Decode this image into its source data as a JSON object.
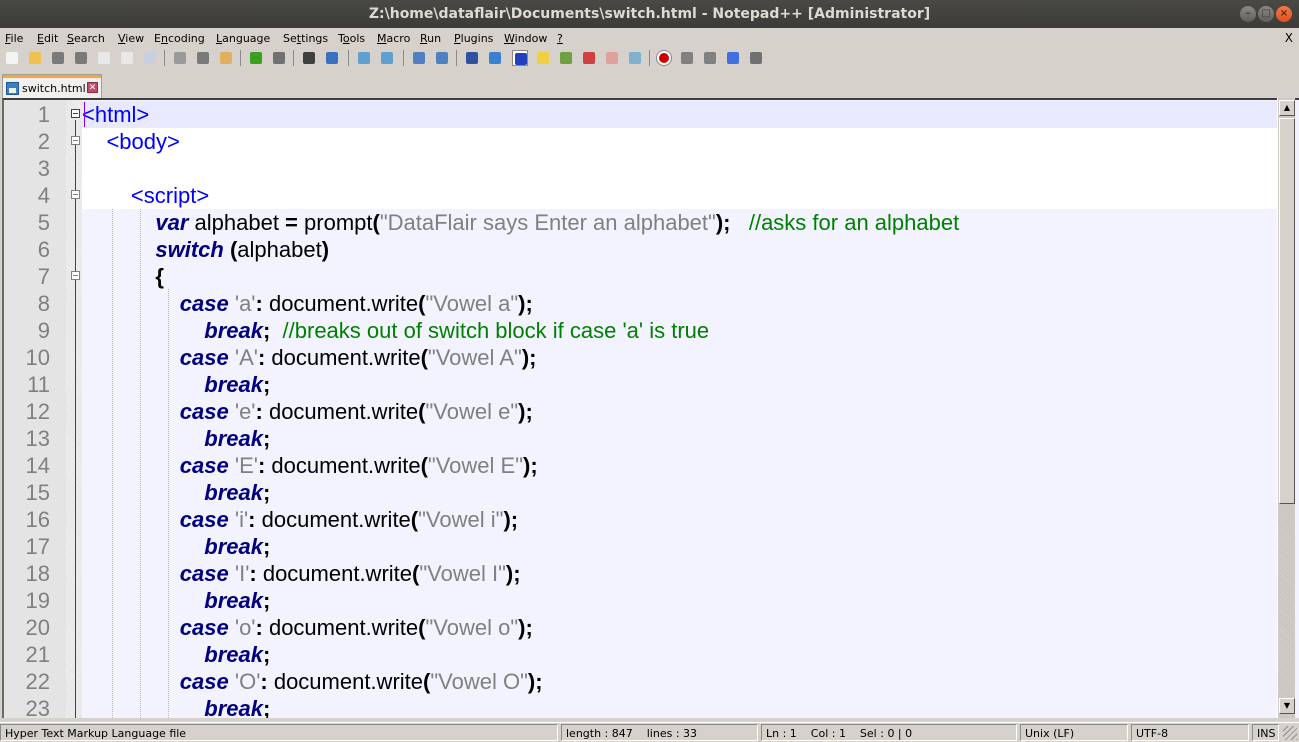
{
  "window": {
    "title": "Z:\\home\\dataflair\\Documents\\switch.html - Notepad++ [Administrator]",
    "controls": {
      "minimize": "–",
      "maximize": "□",
      "close": "×"
    }
  },
  "menu": {
    "items": [
      {
        "label": "File",
        "accel": "F"
      },
      {
        "label": "Edit",
        "accel": "E"
      },
      {
        "label": "Search",
        "accel": "S"
      },
      {
        "label": "View",
        "accel": "V"
      },
      {
        "label": "Encoding",
        "accel": "n"
      },
      {
        "label": "Language",
        "accel": "L"
      },
      {
        "label": "Settings",
        "accel": "t"
      },
      {
        "label": "Tools",
        "accel": "o"
      },
      {
        "label": "Macro",
        "accel": "M"
      },
      {
        "label": "Run",
        "accel": "R"
      },
      {
        "label": "Plugins",
        "accel": "P"
      },
      {
        "label": "Window",
        "accel": "W"
      },
      {
        "label": "?",
        "accel": "?"
      }
    ],
    "close_label": "X"
  },
  "toolbar": {
    "buttons": [
      "new-file-icon",
      "open-file-icon",
      "save-icon",
      "save-all-icon",
      "close-icon",
      "close-all-icon",
      "print-icon",
      "cut-icon",
      "copy-icon",
      "paste-icon",
      "undo-icon",
      "redo-icon",
      "find-icon",
      "replace-icon",
      "zoom-in-icon",
      "zoom-out-icon",
      "sync-vertical-icon",
      "sync-horizontal-icon",
      "word-wrap-icon",
      "show-all-chars-icon",
      "indent-guide-icon",
      "user-defined-language-icon",
      "document-map-icon",
      "function-list-icon",
      "folder-as-workspace-icon",
      "monitoring-icon",
      "record-macro-icon",
      "stop-record-icon",
      "playback-macro-icon",
      "run-macro-multiple-icon",
      "save-macro-icon"
    ]
  },
  "tabs": [
    {
      "label": "switch.html",
      "active": true,
      "close": "✕"
    }
  ],
  "editor": {
    "lines": [
      {
        "n": "1",
        "tokens": [
          [
            "tag",
            "<html>"
          ]
        ]
      },
      {
        "n": "2",
        "tokens": [
          [
            "plain",
            "    "
          ],
          [
            "tag",
            "<body>"
          ]
        ]
      },
      {
        "n": "3",
        "tokens": []
      },
      {
        "n": "4",
        "tokens": [
          [
            "plain",
            "        "
          ],
          [
            "tag",
            "<script>"
          ]
        ]
      },
      {
        "n": "5",
        "tokens": [
          [
            "plain",
            "            "
          ],
          [
            "kw",
            "var"
          ],
          [
            "plain",
            " alphabet "
          ],
          [
            "op",
            "="
          ],
          [
            "plain",
            " prompt"
          ],
          [
            "op",
            "("
          ],
          [
            "str",
            "\"DataFlair says Enter an alphabet\""
          ],
          [
            "op",
            ");"
          ],
          [
            "plain",
            "   "
          ],
          [
            "cmt",
            "//asks for an alphabet"
          ]
        ]
      },
      {
        "n": "6",
        "tokens": [
          [
            "plain",
            "            "
          ],
          [
            "kw",
            "switch"
          ],
          [
            "plain",
            " "
          ],
          [
            "op",
            "("
          ],
          [
            "plain",
            "alphabet"
          ],
          [
            "op",
            ")"
          ]
        ]
      },
      {
        "n": "7",
        "tokens": [
          [
            "plain",
            "            "
          ],
          [
            "op",
            "{"
          ]
        ]
      },
      {
        "n": "8",
        "tokens": [
          [
            "plain",
            "                "
          ],
          [
            "kw",
            "case"
          ],
          [
            "plain",
            " "
          ],
          [
            "str",
            "'a'"
          ],
          [
            "op",
            ":"
          ],
          [
            "plain",
            " document.write"
          ],
          [
            "op",
            "("
          ],
          [
            "str",
            "\"Vowel a\""
          ],
          [
            "op",
            ");"
          ]
        ]
      },
      {
        "n": "9",
        "tokens": [
          [
            "plain",
            "                    "
          ],
          [
            "kw",
            "break"
          ],
          [
            "op",
            ";"
          ],
          [
            "plain",
            "  "
          ],
          [
            "cmt",
            "//breaks out of switch block if case 'a' is true"
          ]
        ]
      },
      {
        "n": "10",
        "tokens": [
          [
            "plain",
            "                "
          ],
          [
            "kw",
            "case"
          ],
          [
            "plain",
            " "
          ],
          [
            "str",
            "'A'"
          ],
          [
            "op",
            ":"
          ],
          [
            "plain",
            " document.write"
          ],
          [
            "op",
            "("
          ],
          [
            "str",
            "\"Vowel A\""
          ],
          [
            "op",
            ");"
          ]
        ]
      },
      {
        "n": "11",
        "tokens": [
          [
            "plain",
            "                    "
          ],
          [
            "kw",
            "break"
          ],
          [
            "op",
            ";"
          ]
        ]
      },
      {
        "n": "12",
        "tokens": [
          [
            "plain",
            "                "
          ],
          [
            "kw",
            "case"
          ],
          [
            "plain",
            " "
          ],
          [
            "str",
            "'e'"
          ],
          [
            "op",
            ":"
          ],
          [
            "plain",
            " document.write"
          ],
          [
            "op",
            "("
          ],
          [
            "str",
            "\"Vowel e\""
          ],
          [
            "op",
            ");"
          ]
        ]
      },
      {
        "n": "13",
        "tokens": [
          [
            "plain",
            "                    "
          ],
          [
            "kw",
            "break"
          ],
          [
            "op",
            ";"
          ]
        ]
      },
      {
        "n": "14",
        "tokens": [
          [
            "plain",
            "                "
          ],
          [
            "kw",
            "case"
          ],
          [
            "plain",
            " "
          ],
          [
            "str",
            "'E'"
          ],
          [
            "op",
            ":"
          ],
          [
            "plain",
            " document.write"
          ],
          [
            "op",
            "("
          ],
          [
            "str",
            "\"Vowel E\""
          ],
          [
            "op",
            ");"
          ]
        ]
      },
      {
        "n": "15",
        "tokens": [
          [
            "plain",
            "                    "
          ],
          [
            "kw",
            "break"
          ],
          [
            "op",
            ";"
          ]
        ]
      },
      {
        "n": "16",
        "tokens": [
          [
            "plain",
            "                "
          ],
          [
            "kw",
            "case"
          ],
          [
            "plain",
            " "
          ],
          [
            "str",
            "'i'"
          ],
          [
            "op",
            ":"
          ],
          [
            "plain",
            " document.write"
          ],
          [
            "op",
            "("
          ],
          [
            "str",
            "\"Vowel i\""
          ],
          [
            "op",
            ");"
          ]
        ]
      },
      {
        "n": "17",
        "tokens": [
          [
            "plain",
            "                    "
          ],
          [
            "kw",
            "break"
          ],
          [
            "op",
            ";"
          ]
        ]
      },
      {
        "n": "18",
        "tokens": [
          [
            "plain",
            "                "
          ],
          [
            "kw",
            "case"
          ],
          [
            "plain",
            " "
          ],
          [
            "str",
            "'I'"
          ],
          [
            "op",
            ":"
          ],
          [
            "plain",
            " document.write"
          ],
          [
            "op",
            "("
          ],
          [
            "str",
            "\"Vowel I\""
          ],
          [
            "op",
            ");"
          ]
        ]
      },
      {
        "n": "19",
        "tokens": [
          [
            "plain",
            "                    "
          ],
          [
            "kw",
            "break"
          ],
          [
            "op",
            ";"
          ]
        ]
      },
      {
        "n": "20",
        "tokens": [
          [
            "plain",
            "                "
          ],
          [
            "kw",
            "case"
          ],
          [
            "plain",
            " "
          ],
          [
            "str",
            "'o'"
          ],
          [
            "op",
            ":"
          ],
          [
            "plain",
            " document.write"
          ],
          [
            "op",
            "("
          ],
          [
            "str",
            "\"Vowel o\""
          ],
          [
            "op",
            ");"
          ]
        ]
      },
      {
        "n": "21",
        "tokens": [
          [
            "plain",
            "                    "
          ],
          [
            "kw",
            "break"
          ],
          [
            "op",
            ";"
          ]
        ]
      },
      {
        "n": "22",
        "tokens": [
          [
            "plain",
            "                "
          ],
          [
            "kw",
            "case"
          ],
          [
            "plain",
            " "
          ],
          [
            "str",
            "'O'"
          ],
          [
            "op",
            ":"
          ],
          [
            "plain",
            " document.write"
          ],
          [
            "op",
            "("
          ],
          [
            "str",
            "\"Vowel O\""
          ],
          [
            "op",
            ");"
          ]
        ]
      },
      {
        "n": "23",
        "tokens": [
          [
            "plain",
            "                    "
          ],
          [
            "kw",
            "break"
          ],
          [
            "op",
            ";"
          ]
        ]
      }
    ],
    "scroll_position_fraction": 0.0,
    "scroll_visible_fraction": 0.7
  },
  "status": {
    "file_type": "Hyper Text Markup Language file",
    "length_lines": "length : 847    lines : 33",
    "cursor": "Ln : 1    Col : 1    Sel : 0 | 0",
    "eol": "Unix (LF)",
    "encoding": "UTF-8",
    "mode": "INS"
  }
}
